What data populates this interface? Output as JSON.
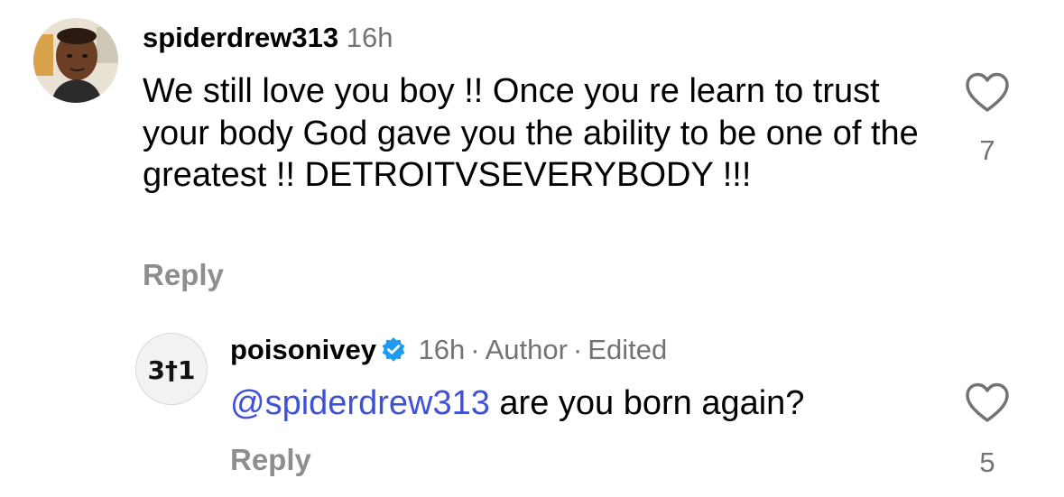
{
  "comments": [
    {
      "username": "spiderdrew313",
      "time": "16h",
      "text": "We still love you boy !! Once you re learn to trust your body God gave you the ability to be one of the greatest !! DETROITVSEVERYBODY !!!",
      "reply_label": "Reply",
      "like_count": "7",
      "icons": {
        "avatar": "user-avatar-photo",
        "like": "heart-outline-icon"
      }
    },
    {
      "username": "poisonivey",
      "verified": true,
      "time": "16h",
      "author_label": "Author",
      "edited_label": "Edited",
      "separator": "·",
      "mention": "@spiderdrew313",
      "text": " are you born again?",
      "reply_label": "Reply",
      "like_count": "5",
      "avatar_text": "3†1",
      "icons": {
        "avatar": "logo-avatar",
        "verified": "verified-badge-icon",
        "like": "heart-outline-icon"
      }
    }
  ],
  "colors": {
    "text": "#000000",
    "muted": "#737373",
    "reply": "#8e8e8e",
    "mention": "#3f51d6",
    "verified": "#1d9bf0"
  }
}
